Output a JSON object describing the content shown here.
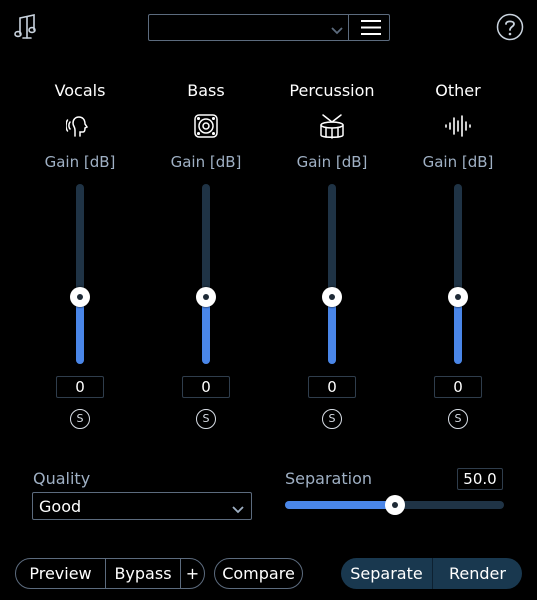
{
  "header": {
    "logo_icon": "music-note-icon",
    "preset_value": "",
    "preset_dropdown_icon": "chevron-down-icon",
    "preset_menu_icon": "hamburger-menu-icon",
    "help_icon": "help-icon"
  },
  "channels": [
    {
      "name": "Vocals",
      "icon": "vocals-head-icon",
      "gain_label": "Gain [dB]",
      "gain_value": "0",
      "slider_level": 0.37,
      "solo_label": "S"
    },
    {
      "name": "Bass",
      "icon": "speaker-icon",
      "gain_label": "Gain [dB]",
      "gain_value": "0",
      "slider_level": 0.37,
      "solo_label": "S"
    },
    {
      "name": "Percussion",
      "icon": "drum-icon",
      "gain_label": "Gain [dB]",
      "gain_value": "0",
      "slider_level": 0.37,
      "solo_label": "S"
    },
    {
      "name": "Other",
      "icon": "waveform-icon",
      "gain_label": "Gain [dB]",
      "gain_value": "0",
      "slider_level": 0.37,
      "solo_label": "S"
    }
  ],
  "quality": {
    "label": "Quality",
    "value": "Good",
    "dropdown_icon": "chevron-down-icon"
  },
  "separation": {
    "label": "Separation",
    "value": "50.0",
    "level": 0.5
  },
  "footer": {
    "preview_label": "Preview",
    "bypass_label": "Bypass",
    "plus_label": "+",
    "compare_label": "Compare",
    "separate_label": "Separate",
    "render_label": "Render"
  },
  "colors": {
    "background": "#000000",
    "accent": "#4a86e8",
    "track": "#1f3345",
    "label": "#9fb0c4",
    "primary_button": "#19384f"
  }
}
